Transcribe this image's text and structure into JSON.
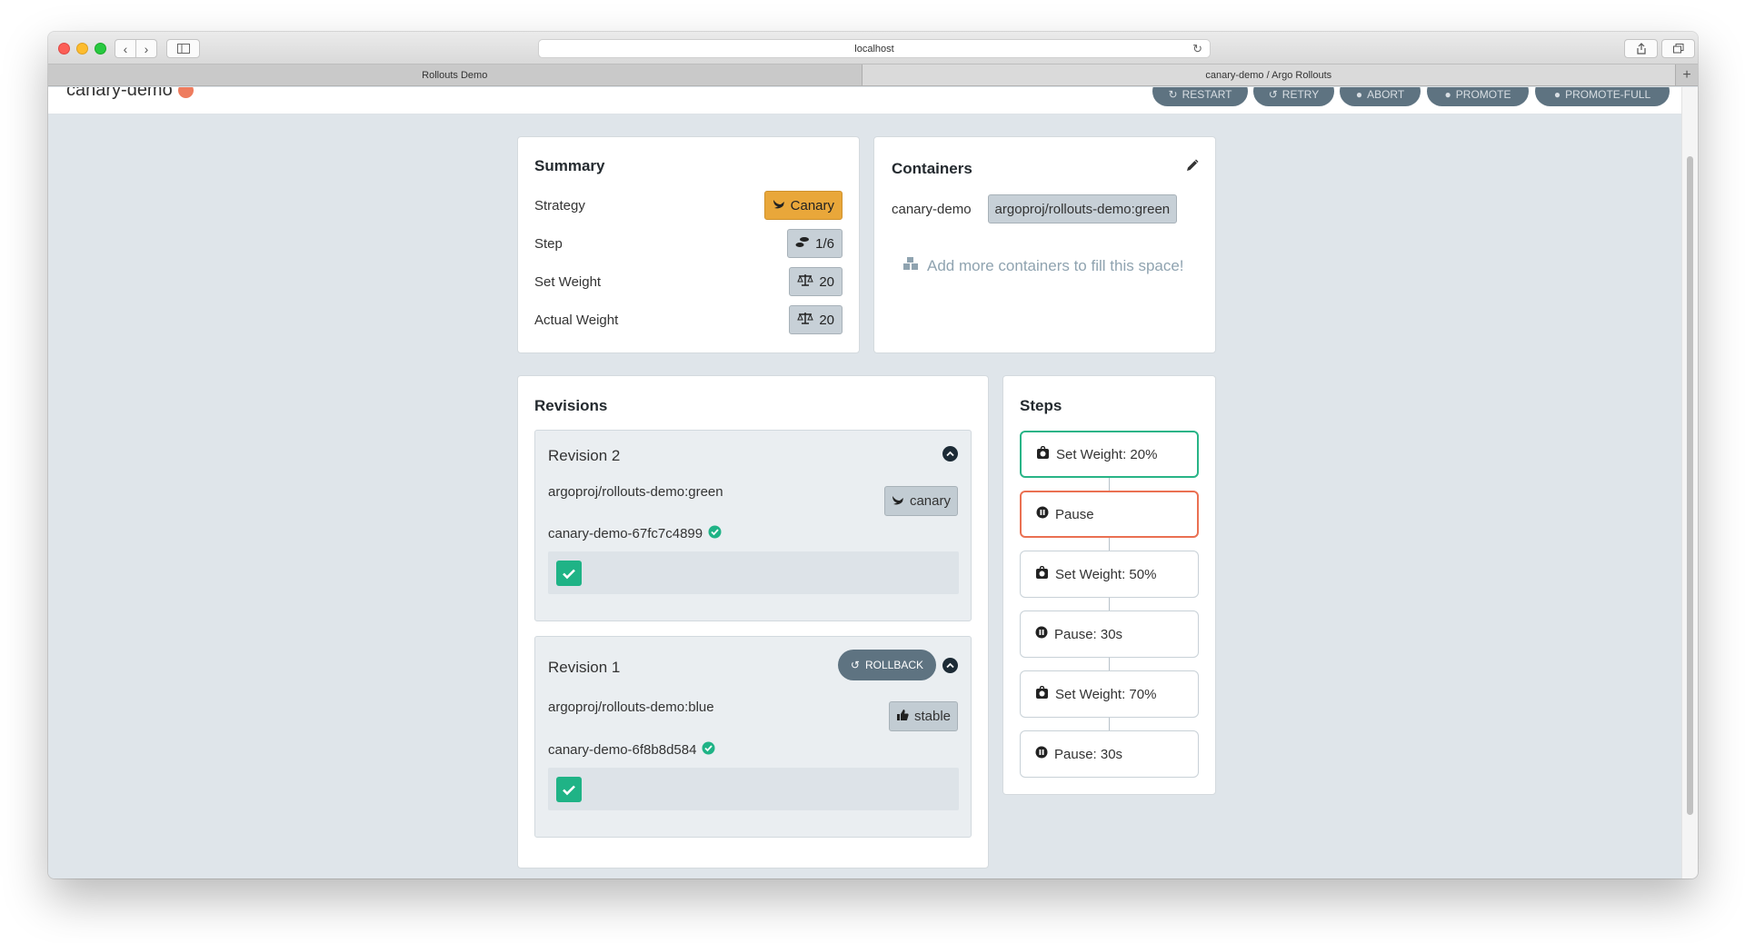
{
  "browser": {
    "url": "localhost",
    "tabs": [
      "Rollouts Demo",
      "canary-demo / Argo Rollouts"
    ],
    "new_tab": "+"
  },
  "header": {
    "rollout_name": "canary-demo",
    "actions": [
      "RESTART",
      "RETRY",
      "ABORT",
      "PROMOTE",
      "PROMOTE-FULL"
    ]
  },
  "summary": {
    "title": "Summary",
    "strategy_label": "Strategy",
    "strategy_value": "Canary",
    "step_label": "Step",
    "step_value": "1/6",
    "set_weight_label": "Set Weight",
    "set_weight_value": "20",
    "actual_weight_label": "Actual Weight",
    "actual_weight_value": "20"
  },
  "containers": {
    "title": "Containers",
    "name": "canary-demo",
    "image": "argoproj/rollouts-demo:green",
    "add_hint": "Add more containers to fill this space!"
  },
  "revisions": {
    "title": "Revisions",
    "items": [
      {
        "title": "Revision 2",
        "image": "argoproj/rollouts-demo:green",
        "replicaset": "canary-demo-67fc7c4899",
        "badge": "canary"
      },
      {
        "title": "Revision 1",
        "image": "argoproj/rollouts-demo:blue",
        "replicaset": "canary-demo-6f8b8d584",
        "badge": "stable",
        "rollback_label": "ROLLBACK"
      }
    ]
  },
  "steps": {
    "title": "Steps",
    "items": [
      {
        "label": "Set Weight: 20%",
        "kind": "weight",
        "state": "complete"
      },
      {
        "label": "Pause",
        "kind": "pause",
        "state": "current"
      },
      {
        "label": "Set Weight: 50%",
        "kind": "weight",
        "state": "pending"
      },
      {
        "label": "Pause: 30s",
        "kind": "pause",
        "state": "pending"
      },
      {
        "label": "Set Weight: 70%",
        "kind": "weight",
        "state": "pending"
      },
      {
        "label": "Pause: 30s",
        "kind": "pause",
        "state": "pending"
      }
    ]
  },
  "colors": {
    "canary": "#e9a73a",
    "healthy": "#1fb386",
    "step_complete": "#28b487",
    "step_current": "#ea7052",
    "action_button": "#5e7381"
  },
  "icons": {
    "strategy": "dove-icon",
    "step": "shoe-prints-icon",
    "weight": "balance-scale-icon",
    "edit": "pencil-icon",
    "containers": "boxes-icon",
    "healthy": "check-circle-icon",
    "collapse": "chevron-up-circle-icon",
    "stable": "thumbs-up-icon",
    "rollback": "undo-icon",
    "weight_step": "weight-icon",
    "pause_step": "pause-circle-icon"
  }
}
